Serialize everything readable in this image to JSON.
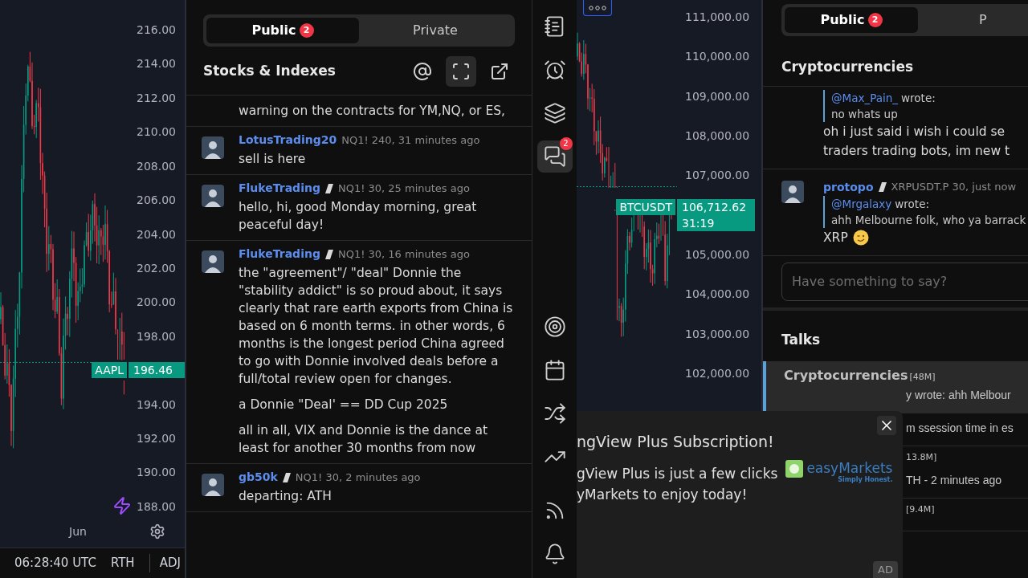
{
  "left_chart": {
    "price_axis": [
      {
        "kind": "tick",
        "text": "216.00"
      },
      {
        "kind": "tick",
        "text": "214.00"
      },
      {
        "kind": "tick",
        "text": "212.00"
      },
      {
        "kind": "tick",
        "text": "210.00"
      },
      {
        "kind": "tick",
        "text": "208.00"
      },
      {
        "kind": "tick",
        "text": "206.00"
      },
      {
        "kind": "tick",
        "text": "204.00"
      },
      {
        "kind": "tick",
        "text": "202.00"
      },
      {
        "kind": "tick",
        "text": "200.00"
      },
      {
        "kind": "tick",
        "text": "198.00"
      },
      {
        "kind": "price_tag",
        "symbol": "AAPL",
        "price": "196.46"
      },
      {
        "kind": "tick",
        "text": "194.00"
      },
      {
        "kind": "tick",
        "text": "192.00"
      },
      {
        "kind": "tick",
        "text": "190.00"
      },
      {
        "kind": "tick",
        "text": "188.00"
      }
    ],
    "time_axis": [
      "Jun"
    ],
    "status_bar": {
      "clock": "06:28:40 UTC",
      "items": [
        "RTH",
        "ADJ"
      ]
    }
  },
  "chat": {
    "tabs": [
      {
        "label": "Public",
        "badge": "2",
        "selected": true
      },
      {
        "label": "Private",
        "selected": false
      }
    ],
    "room": "Stocks & Indexes",
    "actions": [
      {
        "kind": "mention",
        "selected": false
      },
      {
        "kind": "fullscreen",
        "selected": true
      },
      {
        "kind": "popout",
        "selected": false
      }
    ],
    "messages": [
      {
        "body": [
          "warning on the contracts for YM,NQ, or ES,"
        ]
      },
      {
        "author": "LotusTrading20",
        "badge": false,
        "meta": "NQ1! 240, 31 minutes ago",
        "body": [
          "sell is here"
        ]
      },
      {
        "author": "FlukeTrading",
        "badge": true,
        "meta": "NQ1! 30, 25 minutes ago",
        "body": [
          "hello, hi, good Monday morning, great peaceful day!"
        ]
      },
      {
        "author": "FlukeTrading",
        "badge": true,
        "meta": "NQ1! 30, 16 minutes ago",
        "body": [
          "the \"agreement\"/ \"deal\" Donnie the \"stability addict\" is so proud about, it says clearly that rare earth exports from China is based on 6 month terms. in other words, 6 months is the longest period China agreed to go with Donnie involved deals before a full/total review open for changes.",
          "a Donnie \"Deal' == DD Cup 2025",
          "all in all, VIX and Donnie is the dance at least for another 30 months from now"
        ]
      },
      {
        "author": "gb50k",
        "badge": true,
        "meta": "NQ1! 30, 2 minutes ago",
        "body": [
          "departing: ATH"
        ]
      }
    ]
  },
  "toolbar": [
    {
      "kind": "watchlist",
      "selected": false
    },
    {
      "kind": "alerts",
      "selected": false
    },
    {
      "kind": "layers",
      "selected": false
    },
    {
      "kind": "chats",
      "selected": true,
      "badge": "2"
    },
    {
      "kind": "ideas",
      "selected": false
    },
    {
      "kind": "calendar",
      "selected": false
    },
    {
      "kind": "trading",
      "selected": false
    },
    {
      "kind": "chart",
      "selected": false
    },
    {
      "kind": "streams",
      "selected": false
    },
    {
      "kind": "notifications",
      "selected": false
    }
  ],
  "right_chart": {
    "price_axis": [
      {
        "kind": "tick",
        "text": "111,000.00"
      },
      {
        "kind": "tick",
        "text": "110,000.00"
      },
      {
        "kind": "tick",
        "text": "109,000.00"
      },
      {
        "kind": "tick",
        "text": "108,000.00"
      },
      {
        "kind": "tick",
        "text": "107,000.00"
      },
      {
        "kind": "price_tag",
        "symbol": "BTCUSDT",
        "price": "106,712.62",
        "countdown": "31:19"
      },
      {
        "kind": "tick",
        "text": "105,000.00"
      },
      {
        "kind": "tick",
        "text": "104,000.00"
      },
      {
        "kind": "tick",
        "text": "103,000.00"
      },
      {
        "kind": "tick",
        "text": "102,000.00"
      }
    ]
  },
  "right_panel": {
    "tabs": [
      {
        "label": "Public",
        "badge": "2",
        "selected": true
      },
      {
        "label": "P",
        "selected": false
      }
    ],
    "room": "Cryptocurrencies",
    "messages": [
      {
        "quote": {
          "mention": "@Max_Pain_",
          "verb": "wrote:",
          "text": "no whats up"
        },
        "body": [
          "oh i just said i wish i could se",
          "traders trading bots, im new t"
        ],
        "emoji": false
      },
      {
        "author": "protopo",
        "badge": true,
        "meta": "XRPUSDT.P 30, just now",
        "quote": {
          "mention": "@Mrgalaxy",
          "verb": "wrote:",
          "text": "ahh Melbourne folk, who ya barrack"
        },
        "body": [
          "XRP"
        ],
        "emoji": true
      }
    ],
    "input": {
      "placeholder": "Have something to say?"
    },
    "talks_title": "Talks",
    "talks": [
      {
        "title": "Cryptocurrencies",
        "count": "[48M]",
        "preview": "y wrote: ahh Melbour",
        "selected": true
      },
      {
        "preview": "m ssession time in es",
        "selected": false
      },
      {
        "count": "13.8M]",
        "preview": "TH - 2 minutes ago",
        "selected": false
      },
      {
        "count": "[9.4M]",
        "selected": false
      }
    ]
  },
  "ad": {
    "title": "ngView Plus Subscription!",
    "lines": [
      "gView Plus is just a few clicks",
      "yMarkets to enjoy today!"
    ],
    "logo": {
      "name": "easyMarkets",
      "tagline": "Simply Honest."
    },
    "label": "AD"
  }
}
